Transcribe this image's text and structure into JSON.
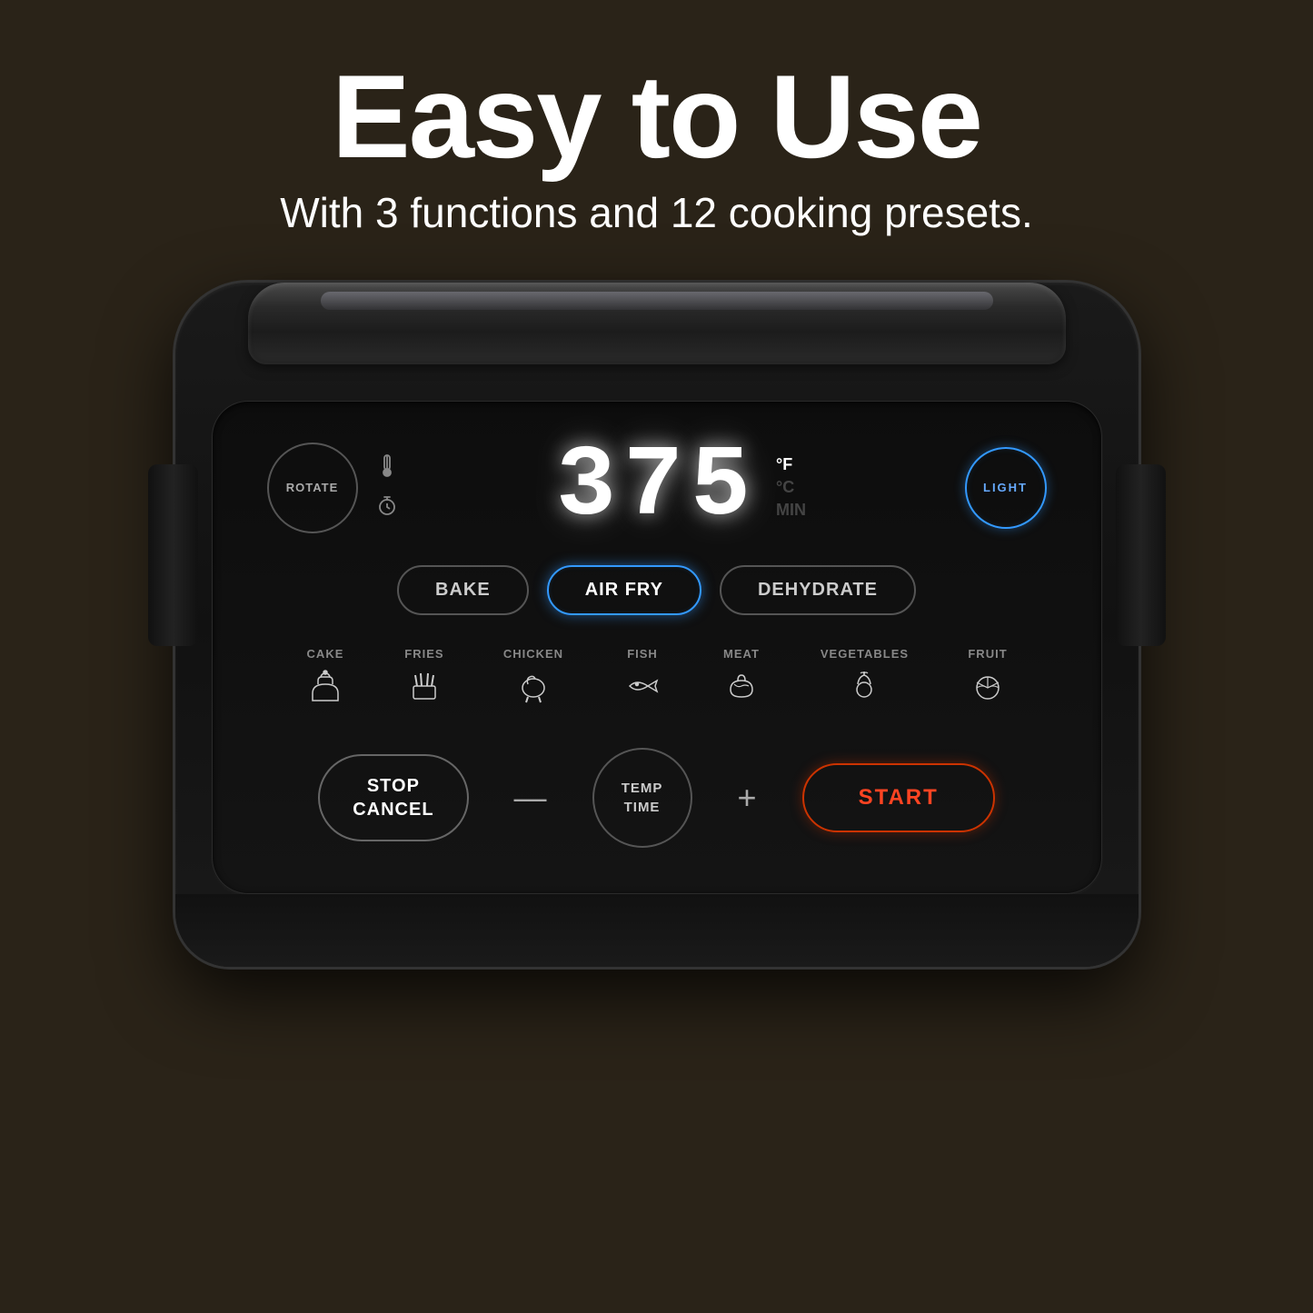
{
  "hero": {
    "title": "Easy to Use",
    "subtitle": "With 3 functions and 12 cooking presets."
  },
  "display": {
    "temperature": "375",
    "unit_f": "°F",
    "unit_c": "°C",
    "unit_time": "MIN"
  },
  "buttons": {
    "rotate": "ROTATE",
    "light": "LIGHT",
    "bake": "BAKE",
    "air_fry": "AIR FRY",
    "dehydrate": "DEHYDRATE",
    "stop_cancel": "STOP\nCANCEL",
    "minus": "—",
    "plus": "+",
    "temp_time": "TEMP\nTIME",
    "start": "START"
  },
  "presets": [
    {
      "label": "CAKE",
      "icon": "cake"
    },
    {
      "label": "FRIES",
      "icon": "fries"
    },
    {
      "label": "CHICKEN",
      "icon": "chicken"
    },
    {
      "label": "FISH",
      "icon": "fish"
    },
    {
      "label": "MEAT",
      "icon": "meat"
    },
    {
      "label": "VEGETABLES",
      "icon": "vegetables"
    },
    {
      "label": "FRUIT",
      "icon": "fruit"
    }
  ],
  "colors": {
    "accent_blue": "#3399ff",
    "accent_red": "#cc3300",
    "bg": "#2a2318",
    "panel": "#0d0d0d"
  }
}
